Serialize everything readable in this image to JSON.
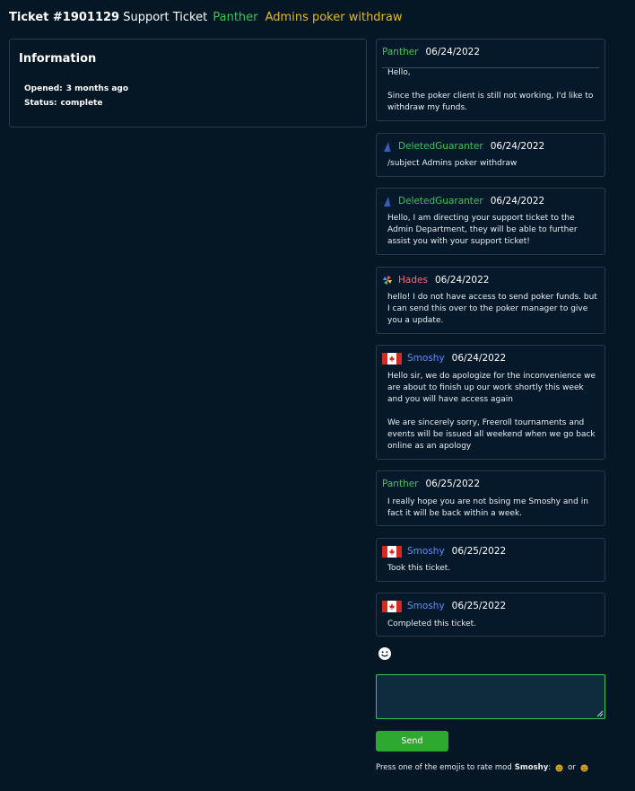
{
  "header": {
    "ticket_no": "Ticket #1901129",
    "type": "Support Ticket",
    "user": "Panther",
    "subject": "Admins poker withdraw"
  },
  "info": {
    "title": "Information",
    "opened_label": "Opened:",
    "opened_value": "3 months ago",
    "status_label": "Status:",
    "status_value": "complete"
  },
  "messages": [
    {
      "author": "Panther",
      "date": "06/24/2022",
      "lines": [
        "Hello,",
        "Since the poker client is still not working, I'd like to withdraw my funds."
      ]
    },
    {
      "author": "DeletedGuaranter",
      "date": "06/24/2022",
      "lines": [
        "/subject Admins poker withdraw"
      ]
    },
    {
      "author": "DeletedGuaranter",
      "date": "06/24/2022",
      "lines": [
        "Hello, I am directing your support ticket to the Admin Department, they will be able to further assist you with your support ticket!"
      ]
    },
    {
      "author": "Hades",
      "date": "06/24/2022",
      "lines": [
        "hello! I do not have access to send poker funds. but I can send this over to the poker manager to give you a update."
      ]
    },
    {
      "author": "Smoshy",
      "date": "06/24/2022",
      "lines": [
        "Hello sir, we do apologize for the inconvenience we are about to finish up our work shortly this week and you will have access again",
        "We are sincerely sorry, Freeroll tournaments and events will be issued all weekend when we go back online as an apology"
      ]
    },
    {
      "author": "Panther",
      "date": "06/25/2022",
      "lines": [
        "I really hope you are not bsing me Smoshy and in fact it will be back within a week."
      ]
    },
    {
      "author": "Smoshy",
      "date": "06/25/2022",
      "lines": [
        "Took this ticket."
      ]
    },
    {
      "author": "Smoshy",
      "date": "06/25/2022",
      "lines": [
        "Completed this ticket."
      ]
    }
  ],
  "composer": {
    "emoji_icon": "smiley-icon",
    "placeholder": "",
    "send_label": "Send"
  },
  "rating": {
    "prefix": "Press one of the emojis to rate mod",
    "mod": "Smoshy",
    "colon": ":",
    "or": "or",
    "good_icon": "happy-face-icon",
    "bad_icon": "sad-face-icon"
  },
  "colors": {
    "background": "#051625",
    "panther": "#3ec45a",
    "subject": "#e7b923",
    "smoshy": "#5b8dff",
    "hades": "#ff6b6b",
    "send_button": "#2ea82e"
  }
}
